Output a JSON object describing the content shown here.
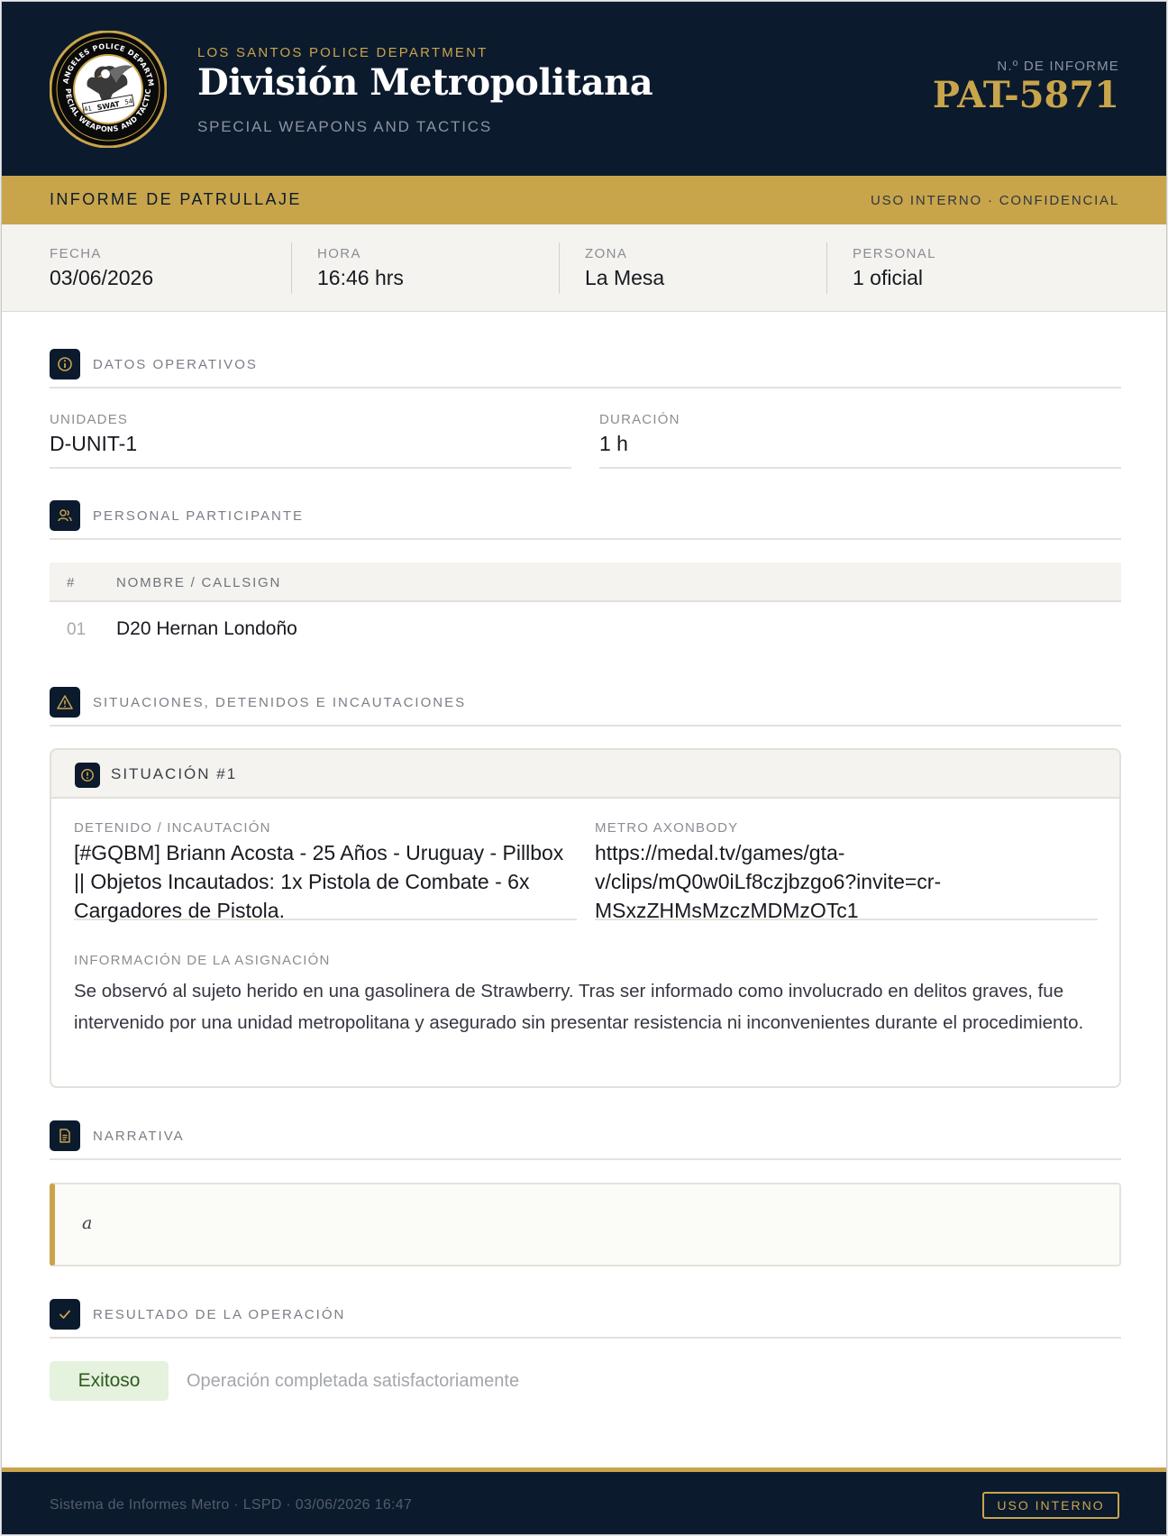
{
  "header": {
    "department": "LOS SANTOS POLICE DEPARTMENT",
    "division": "División Metropolitana",
    "unit": "SPECIAL WEAPONS AND TACTICS",
    "report_label": "N.º DE INFORME",
    "report_number": "PAT-5871",
    "seal": {
      "ring_top": "LOS ANGELES POLICE DEPARTMENT",
      "ring_bottom": "SPECIAL WEAPONS AND TACTICS",
      "banner": "SWAT",
      "left_number": "41",
      "right_number": "54",
      "icon": "eagle-icon"
    }
  },
  "banner": {
    "title": "INFORME DE PATRULLAJE",
    "classification": "USO INTERNO · CONFIDENCIAL"
  },
  "meta": [
    {
      "label": "FECHA",
      "value": "03/06/2026"
    },
    {
      "label": "HORA",
      "value": "16:46 hrs"
    },
    {
      "label": "ZONA",
      "value": "La Mesa"
    },
    {
      "label": "PERSONAL",
      "value": "1 oficial"
    }
  ],
  "sections": {
    "operativos": {
      "title": "DATOS OPERATIVOS",
      "icon": "info-icon"
    },
    "personal": {
      "title": "PERSONAL PARTICIPANTE",
      "icon": "users-icon"
    },
    "situaciones": {
      "title": "SITUACIONES, DETENIDOS E INCAUTACIONES",
      "icon": "warning-icon"
    },
    "narrativa": {
      "title": "NARRATIVA",
      "icon": "document-icon"
    },
    "resultado": {
      "title": "RESULTADO DE LA OPERACIÓN",
      "icon": "check-icon"
    }
  },
  "operativos": {
    "unidades_label": "UNIDADES",
    "unidades_value": "D-UNIT-1",
    "duracion_label": "DURACIÓN",
    "duracion_value": "1 h"
  },
  "personal": {
    "columns": [
      "#",
      "NOMBRE / CALLSIGN"
    ],
    "rows": [
      {
        "num": "01",
        "name": "D20 Hernan Londoño"
      }
    ]
  },
  "situacion": {
    "title": "SITUACIÓN #1",
    "icon": "alert-circle-icon",
    "detenido_label": "DETENIDO / INCAUTACIÓN",
    "detenido_value": "[#GQBM] Briann Acosta - 25 Años - Uruguay - Pillbox || Objetos Incautados: 1x Pistola de Combate - 6x Cargadores de Pistola.",
    "axon_label": "METRO AXONBODY",
    "axon_value": "https://medal.tv/games/gta-v/clips/mQ0w0iLf8czjbzgo6?invite=cr-MSxzZHMsMzczMDMzOTc1",
    "asignacion_label": "INFORMACIÓN DE LA ASIGNACIÓN",
    "asignacion_value": "Se observó al sujeto herido en una gasolinera de Strawberry. Tras ser informado como involucrado en delitos graves, fue intervenido por una unidad metropolitana y asegurado sin presentar resistencia ni inconvenientes durante el procedimiento."
  },
  "narrativa": {
    "text": "a"
  },
  "resultado": {
    "status": "Exitoso",
    "description": "Operación completada satisfactoriamente"
  },
  "footer": {
    "text": "Sistema de Informes Metro · LSPD · 03/06/2026 16:47",
    "badge": "USO INTERNO"
  },
  "colors": {
    "navy": "#0c1a2e",
    "gold": "#c8a54b",
    "success_bg": "#e5f2dd",
    "success_text": "#2e5a1f"
  }
}
